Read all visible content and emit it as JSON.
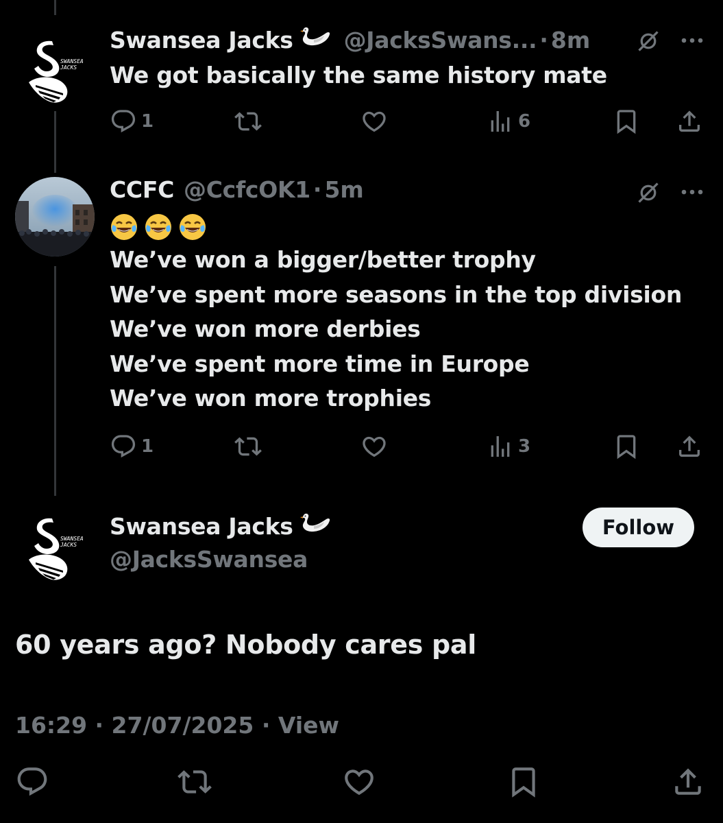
{
  "colors": {
    "background": "#000000",
    "text": "#e7e9ea",
    "muted": "#71767b",
    "thread_line": "#333639",
    "follow_bg": "#eff3f4"
  },
  "tweets": [
    {
      "name": "Swansea Jacks",
      "name_emoji": "swan",
      "handle": "@JacksSwans...",
      "separator": "·",
      "time": "8m",
      "avatar_label": "SWANSEA JACKS",
      "lines": [
        "We got basically the same history mate"
      ],
      "replies": "1",
      "views": "6"
    },
    {
      "name": "CCFC",
      "handle": "@CcfcOK1",
      "separator": "·",
      "time": "5m",
      "emojis": [
        "face-with-tears-of-joy",
        "face-with-tears-of-joy",
        "face-with-tears-of-joy"
      ],
      "lines": [
        "We’ve won a bigger/better trophy",
        "We’ve spent more seasons in the top division",
        "We’ve won more derbies",
        "We’ve spent more time in Europe",
        "We’ve won more trophies"
      ],
      "replies": "1",
      "views": "3"
    }
  ],
  "main_tweet": {
    "name": "Swansea Jacks",
    "name_emoji": "swan",
    "handle": "@JacksSwansea",
    "avatar_label": "SWANSEA JACKS",
    "follow_label": "Follow",
    "text": "60 years ago? Nobody cares pal",
    "timestamp": "16:29 · 27/07/2025 · ",
    "view_label": "View"
  },
  "icons": [
    "reply-icon",
    "retweet-icon",
    "like-icon",
    "views-icon",
    "bookmark-icon",
    "share-icon",
    "grok-icon",
    "more-icon"
  ]
}
